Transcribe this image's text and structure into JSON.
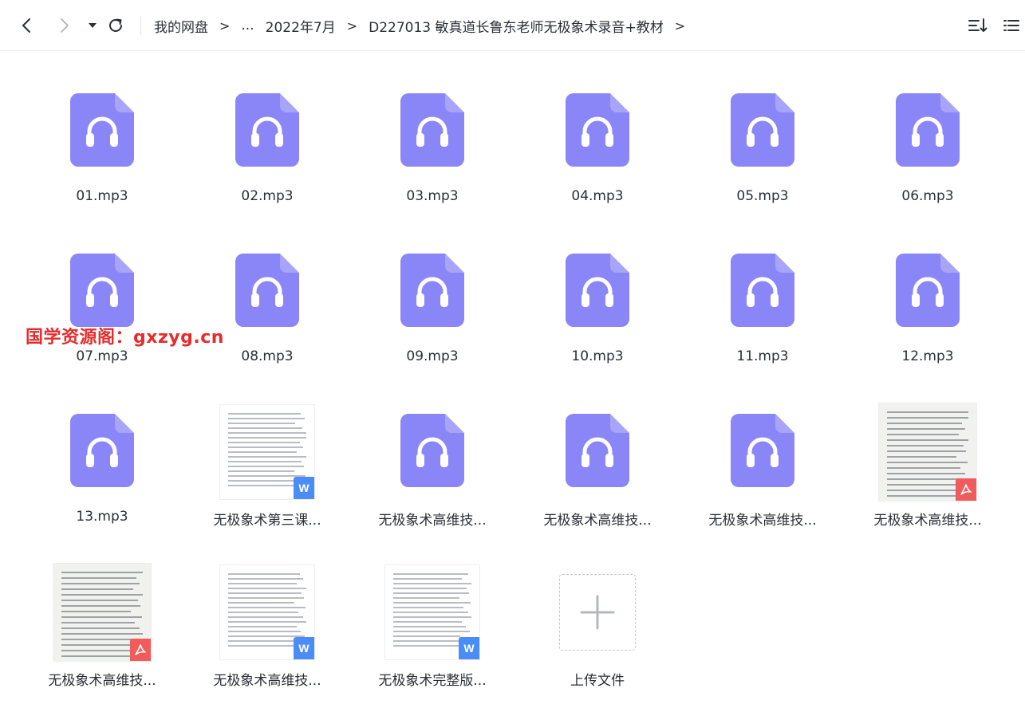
{
  "toolbar": {
    "icons": {
      "back": "chevron-left-icon",
      "forward": "chevron-right-icon",
      "history": "caret-down-icon",
      "refresh": "refresh-icon",
      "sort": "sort-icon",
      "view": "list-view-icon"
    },
    "breadcrumb": {
      "root": "我的网盘",
      "ellipsis": "...",
      "folder1": "2022年7月",
      "folder2": "D227013 敏真道长鲁东老师无极象术录音+教材",
      "separator": ">"
    }
  },
  "files": [
    {
      "name": "01.mp3",
      "type": "audio"
    },
    {
      "name": "02.mp3",
      "type": "audio"
    },
    {
      "name": "03.mp3",
      "type": "audio"
    },
    {
      "name": "04.mp3",
      "type": "audio"
    },
    {
      "name": "05.mp3",
      "type": "audio"
    },
    {
      "name": "06.mp3",
      "type": "audio"
    },
    {
      "name": "07.mp3",
      "type": "audio"
    },
    {
      "name": "08.mp3",
      "type": "audio"
    },
    {
      "name": "09.mp3",
      "type": "audio"
    },
    {
      "name": "10.mp3",
      "type": "audio"
    },
    {
      "name": "11.mp3",
      "type": "audio"
    },
    {
      "name": "12.mp3",
      "type": "audio"
    },
    {
      "name": "13.mp3",
      "type": "audio"
    },
    {
      "name": "无极象术第三课...",
      "type": "word"
    },
    {
      "name": "无极象术高维技...",
      "type": "audio"
    },
    {
      "name": "无极象术高维技...",
      "type": "audio"
    },
    {
      "name": "无极象术高维技...",
      "type": "audio"
    },
    {
      "name": "无极象术高维技...",
      "type": "pdf"
    },
    {
      "name": "无极象术高维技...",
      "type": "pdf"
    },
    {
      "name": "无极象术高维技...",
      "type": "word"
    },
    {
      "name": "无极象术完整版...",
      "type": "word"
    }
  ],
  "upload": {
    "label": "上传文件"
  },
  "watermark": "国学资源阁：gxzyg.cn",
  "colors": {
    "audio_icon": "#8b86f7",
    "word_badge": "#4a8df8",
    "pdf_badge": "#f15b5b",
    "watermark": "#e52c2c"
  },
  "badge_letters": {
    "word": "W"
  }
}
